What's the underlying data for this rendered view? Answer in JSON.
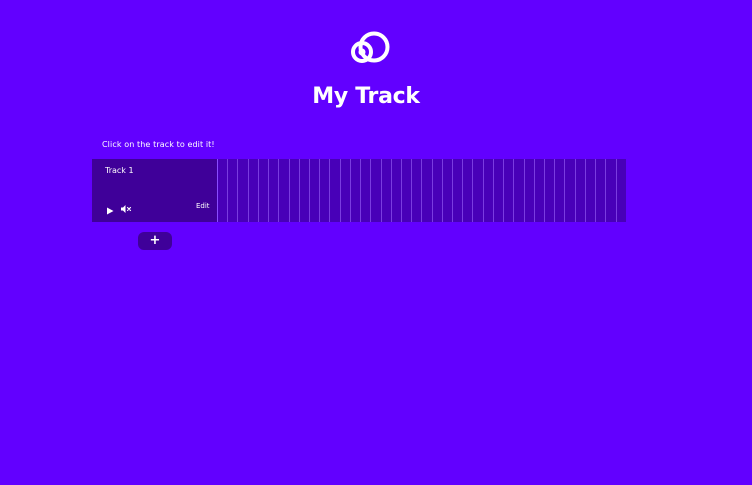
{
  "header": {
    "logo_icon": "linked-circles-logo",
    "title": "My Track"
  },
  "hint": "Click on the track to edit it!",
  "tracks": [
    {
      "name": "Track 1",
      "play_icon": "play-icon",
      "mute_icon": "speaker-muted-icon",
      "edit_label": "Edit",
      "step_count": 40
    }
  ],
  "add_track_label": "+",
  "colors": {
    "background": "#6200ff",
    "track_panel": "#3f0099",
    "timeline": "#4800b8",
    "grid_line": "#7a3ce0",
    "text": "#ffffff"
  }
}
